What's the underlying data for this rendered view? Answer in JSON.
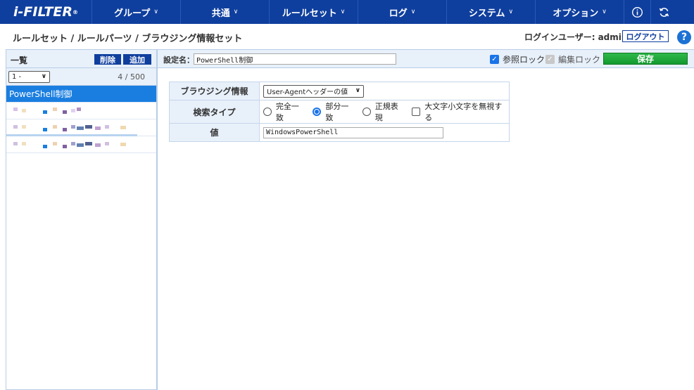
{
  "nav": {
    "logo": "i-FILTER",
    "items": [
      {
        "label": "グループ"
      },
      {
        "label": "共通"
      },
      {
        "label": "ルールセット"
      },
      {
        "label": "ログ"
      },
      {
        "label": "システム"
      },
      {
        "label": "オプション"
      }
    ],
    "icons": [
      "info-icon",
      "refresh-icon"
    ]
  },
  "breadcrumb": "ルールセット / ルールパーツ / ブラウジング情報セット",
  "login": {
    "label": "ログインユーザー:",
    "user": "admin",
    "logout": "ログアウト"
  },
  "help": "?",
  "left": {
    "title": "一覧",
    "delete": "削除",
    "add": "追加",
    "range": "1 -",
    "count": "4 / 500",
    "items": [
      {
        "label": "PowerShell制御",
        "active": true
      }
    ]
  },
  "main": {
    "name_label": "設定名：",
    "name_value": "PowerShell制御",
    "ref_lock": "参照ロック",
    "edit_lock": "編集ロック",
    "save": "保存"
  },
  "form": {
    "browse_label": "ブラウジング情報",
    "browse_value": "User-Agentヘッダーの値",
    "search_label": "検索タイプ",
    "options": [
      "完全一致",
      "部分一致",
      "正規表現"
    ],
    "selected_option": "部分一致",
    "ignore_case": "大文字小文字を無視する",
    "value_label": "値",
    "value": "WindowsPowerShell"
  },
  "colors": {
    "nav_bg": "#0f3f9e",
    "active_item": "#1a7ee0",
    "save_btn": "#139a2f"
  }
}
